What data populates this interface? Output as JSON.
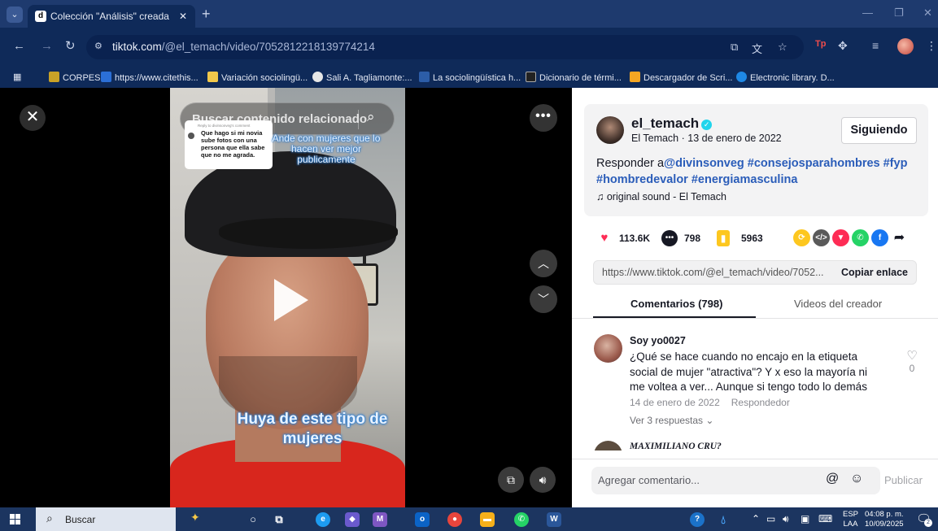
{
  "browser": {
    "tab_title": "Colección \"Análisis\" creada por",
    "tab_favicon_glyph": "d",
    "url_host": "tiktok.com",
    "url_path": "/@el_temach/video/7052812218139774214",
    "bookmarks": [
      {
        "label": "CORPES",
        "color": "#c9a227"
      },
      {
        "label": "https://www.citethis...",
        "color": "#2b6fd6"
      },
      {
        "label": "Variación sociolingü...",
        "color": "#f1c84b"
      },
      {
        "label": "Sali A. Tagliamonte:...",
        "color": "#e6e6e6"
      },
      {
        "label": "La sociolingüística h...",
        "color": "#2c5da8"
      },
      {
        "label": "Dicionario de térmi...",
        "color": "#222222"
      },
      {
        "label": "Descargador de Scri...",
        "color": "#f5a623"
      },
      {
        "label": "Electronic library. D...",
        "color": "#1e88e5"
      }
    ]
  },
  "video": {
    "search_placeholder": "Buscar contenido relacionado",
    "reply_card_header": "Reply to divinsonveg's comment",
    "reply_card_text": "Que hago si mi novia sube fotos con una persona que ella sabe que no me agrada.",
    "overlay_top_text": "Ande con mujeres que lo hacen ver mejor publicamente",
    "overlay_bottom_text": "Huya de este tipo de mujeres"
  },
  "author": {
    "name": "el_temach",
    "subtitle": "El Temach · 13 de enero de 2022",
    "follow_label": "Siguiendo"
  },
  "post": {
    "caption_prefix": "Responder a",
    "caption_tags": "@divinsonveg #consejosparahombres #fyp #hombredevalor #energiamasculina",
    "sound": "original sound - El Temach",
    "likes": "113.6K",
    "comments": "798",
    "saves": "5963",
    "link": "https://www.tiktok.com/@el_temach/video/7052...",
    "copy_label": "Copiar enlace"
  },
  "tabs": {
    "comments": "Comentarios (798)",
    "creator_videos": "Videos del creador"
  },
  "comments": [
    {
      "user": "Soy yo0027",
      "text": "¿Qué se hace cuando no encajo en la etiqueta social de mujer \"atractiva\"? Y x eso la mayoría ni me voltea a ver... Aunque si tengo todo lo demás",
      "date": "14 de enero de 2022",
      "reply_label": "Respondedor",
      "more_replies": "Ver 3 respuestas",
      "likes": "0"
    },
    {
      "user": "MAXIMILIANO CRU?"
    }
  ],
  "composer": {
    "placeholder": "Agregar comentario...",
    "publish_label": "Publicar"
  },
  "taskbar": {
    "search_label": "Buscar",
    "lang_top": "ESP",
    "lang_bottom": "LAA",
    "time": "04:08 p. m.",
    "date": "10/09/2025",
    "notif_count": "2"
  },
  "colors": {
    "accent_red": "#fe2c55",
    "hashtag_blue": "#2b5db9",
    "chrome_blue": "#0f2a59"
  }
}
